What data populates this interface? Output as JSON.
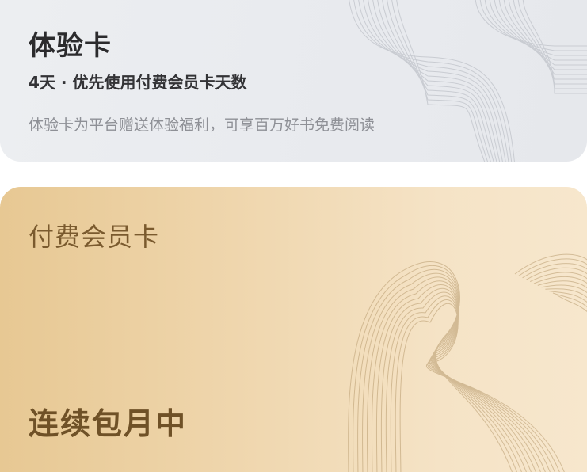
{
  "trial_card": {
    "title": "体验卡",
    "subtitle": "4天 · 优先使用付费会员卡天数",
    "description": "体验卡为平台赠送体验福利，可享百万好书免费阅读",
    "background_color": "#eaecef",
    "pattern_color": "#c9ccd2"
  },
  "paid_card": {
    "title": "付费会员卡",
    "status": "连续包月中",
    "background_color": "#f0d9b2",
    "pattern_color": "#b79a6d",
    "text_color": "#7a5a2e"
  }
}
